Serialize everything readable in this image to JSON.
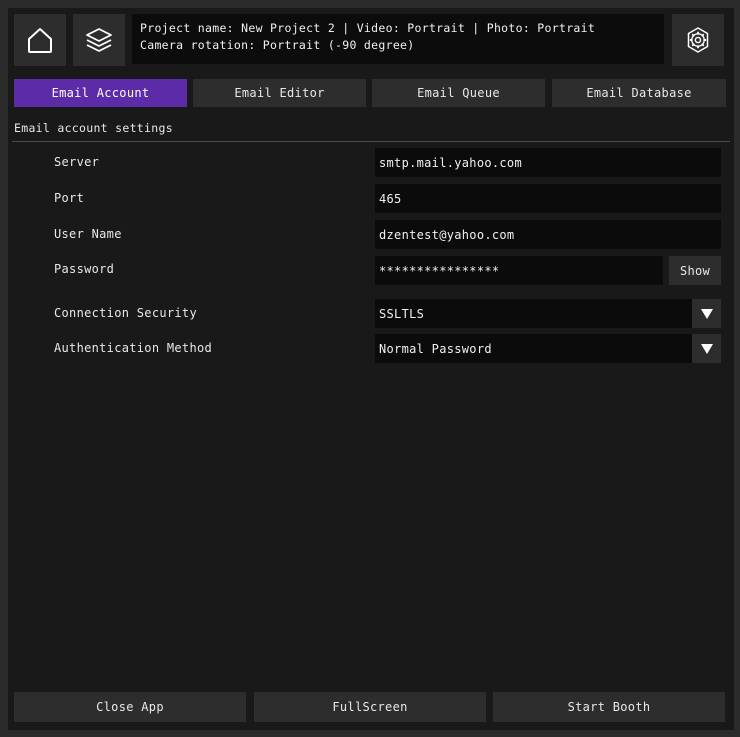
{
  "header": {
    "home_icon": "home-icon",
    "layers_icon": "layers-icon",
    "settings_icon": "gear-icon",
    "info_line1": "Project name: New Project 2 | Video: Portrait | Photo: Portrait",
    "info_line2": "Camera rotation: Portrait (-90 degree)"
  },
  "tabs": [
    {
      "label": "Email Account",
      "active": true
    },
    {
      "label": "Email Editor",
      "active": false
    },
    {
      "label": "Email Queue",
      "active": false
    },
    {
      "label": "Email Database",
      "active": false
    }
  ],
  "section_title": "Email account settings",
  "form": {
    "server": {
      "label": "Server",
      "value": "smtp.mail.yahoo.com"
    },
    "port": {
      "label": "Port",
      "value": "465"
    },
    "user_name": {
      "label": "User Name",
      "value": "dzentest@yahoo.com"
    },
    "password": {
      "label": "Password",
      "value": "****************",
      "show_label": "Show"
    },
    "connection_security": {
      "label": "Connection Security",
      "value": "SSLTLS"
    },
    "authentication_method": {
      "label": "Authentication Method",
      "value": "Normal Password"
    }
  },
  "footer": {
    "close_label": "Close App",
    "fullscreen_label": "FullScreen",
    "start_label": "Start Booth"
  },
  "colors": {
    "accent": "#5c2ba8",
    "background": "#191919",
    "button": "#2d2d2d",
    "field": "#0b0b0b"
  }
}
